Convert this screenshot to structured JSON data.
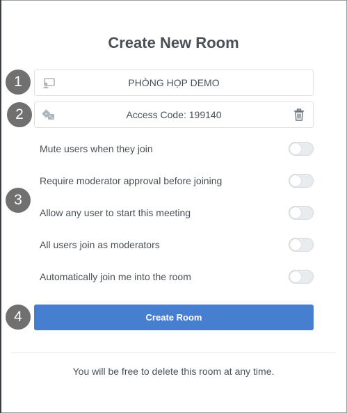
{
  "dialog": {
    "title": "Create New Room",
    "footer_note": "You will be free to delete this room at any time."
  },
  "badges": [
    "1",
    "2",
    "3",
    "4"
  ],
  "room_name": {
    "value": "PHÒNG HỌP DEMO",
    "icon": "room-icon"
  },
  "access_code": {
    "text": "Access Code: 199140",
    "icon": "dice-icon",
    "delete_icon": "trash-icon"
  },
  "options": [
    {
      "label": "Mute users when they join",
      "enabled": false
    },
    {
      "label": "Require moderator approval before joining",
      "enabled": false
    },
    {
      "label": "Allow any user to start this meeting",
      "enabled": false
    },
    {
      "label": "All users join as moderators",
      "enabled": false
    },
    {
      "label": "Automatically join me into the room",
      "enabled": false
    }
  ],
  "create_button": {
    "label": "Create Room"
  },
  "colors": {
    "accent": "#467fcf",
    "badge": "#707070",
    "text": "#495057"
  }
}
